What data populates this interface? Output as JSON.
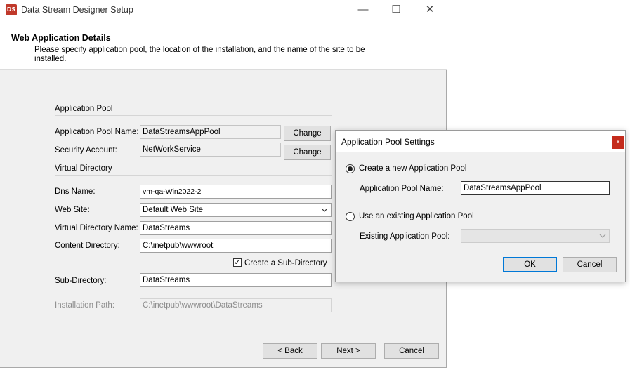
{
  "window": {
    "title": "Data Stream Designer Setup",
    "logo_text": "DS",
    "minimize": "—",
    "maximize": "☐",
    "close": "✕"
  },
  "header": {
    "title": "Web Application Details",
    "description": "Please specify application pool, the location of the installation, and the name of the site to be installed."
  },
  "form": {
    "app_pool_section": "Application Pool",
    "app_pool_name_label": "Application Pool Name:",
    "app_pool_name_value": "DataStreamsAppPool",
    "security_account_label": "Security Account:",
    "security_account_value": "NetWorkService",
    "change_label": "Change",
    "virtual_dir_section": "Virtual Directory",
    "dns_name_label": "Dns Name:",
    "dns_name_value": "vm-qa-Win2022-2",
    "web_site_label": "Web Site:",
    "web_site_value": "Default Web Site",
    "vdir_name_label": "Virtual Directory Name:",
    "vdir_name_value": "DataStreams",
    "content_dir_label": "Content Directory:",
    "content_dir_value": "C:\\inetpub\\wwwroot",
    "create_subdir_label": "Create a Sub-Directory",
    "create_subdir_checked": true,
    "subdir_label": "Sub-Directory:",
    "subdir_value": "DataStreams",
    "install_path_label": "Installation Path:",
    "install_path_value": "C:\\inetpub\\wwwroot\\DataStreams"
  },
  "footer": {
    "back_label": "< Back",
    "next_label": "Next >",
    "cancel_label": "Cancel"
  },
  "dialog": {
    "title": "Application Pool Settings",
    "close_glyph": "×",
    "create_new_label": "Create a new Application Pool",
    "create_new_selected": true,
    "pool_name_label": "Application Pool Name:",
    "pool_name_value": "DataStreamsAppPool",
    "use_existing_label": "Use an existing Application Pool",
    "existing_pool_label": "Existing Application Pool:",
    "existing_pool_value": "",
    "ok_label": "OK",
    "cancel_label": "Cancel"
  }
}
